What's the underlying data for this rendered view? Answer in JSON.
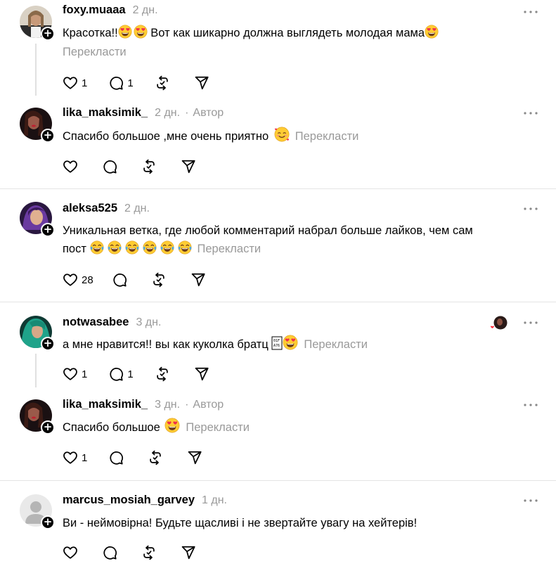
{
  "translate_label": "Перекласти",
  "author_label": "Автор",
  "comments": [
    {
      "user": "foxy.muaaa",
      "time": "2 дн.",
      "text": "Красотка!!",
      "text2": " Вот как шикарно должна выглядеть молодая мама",
      "likes": "1",
      "replies": "1"
    },
    {
      "user": "lika_maksimik_",
      "time": "2 дн.",
      "text": "Спасибо большое ,мне очень приятно"
    },
    {
      "user": "aleksa525",
      "time": "2 дн.",
      "text_line1": "Уникальная ветка, где любой комментарий набрал больше лайков, чем сам",
      "text_line2": "пост",
      "likes": "28"
    },
    {
      "user": "notwasabee",
      "time": "3 дн.",
      "text": "а мне нравится!! вы как куколка братц",
      "likes": "1",
      "replies": "1"
    },
    {
      "user": "lika_maksimik_",
      "time": "3 дн.",
      "text": "Спасибо большое",
      "likes": "1"
    },
    {
      "user": "marcus_mosiah_garvey",
      "time": "1 дн.",
      "text": "Ви - неймовірна! Будьте щасливі і не звертайте увагу на хейтерів!"
    }
  ],
  "colors": {
    "muted": "#999999",
    "separator": "#e4e4e4",
    "like_red": "#ff3040"
  },
  "icons": [
    "heart-icon",
    "comment-icon",
    "repost-icon",
    "share-icon",
    "more-icon",
    "plus-follow-icon",
    "heart-eyes-emoji",
    "tears-of-joy-emoji",
    "smiling-hearts-emoji"
  ]
}
